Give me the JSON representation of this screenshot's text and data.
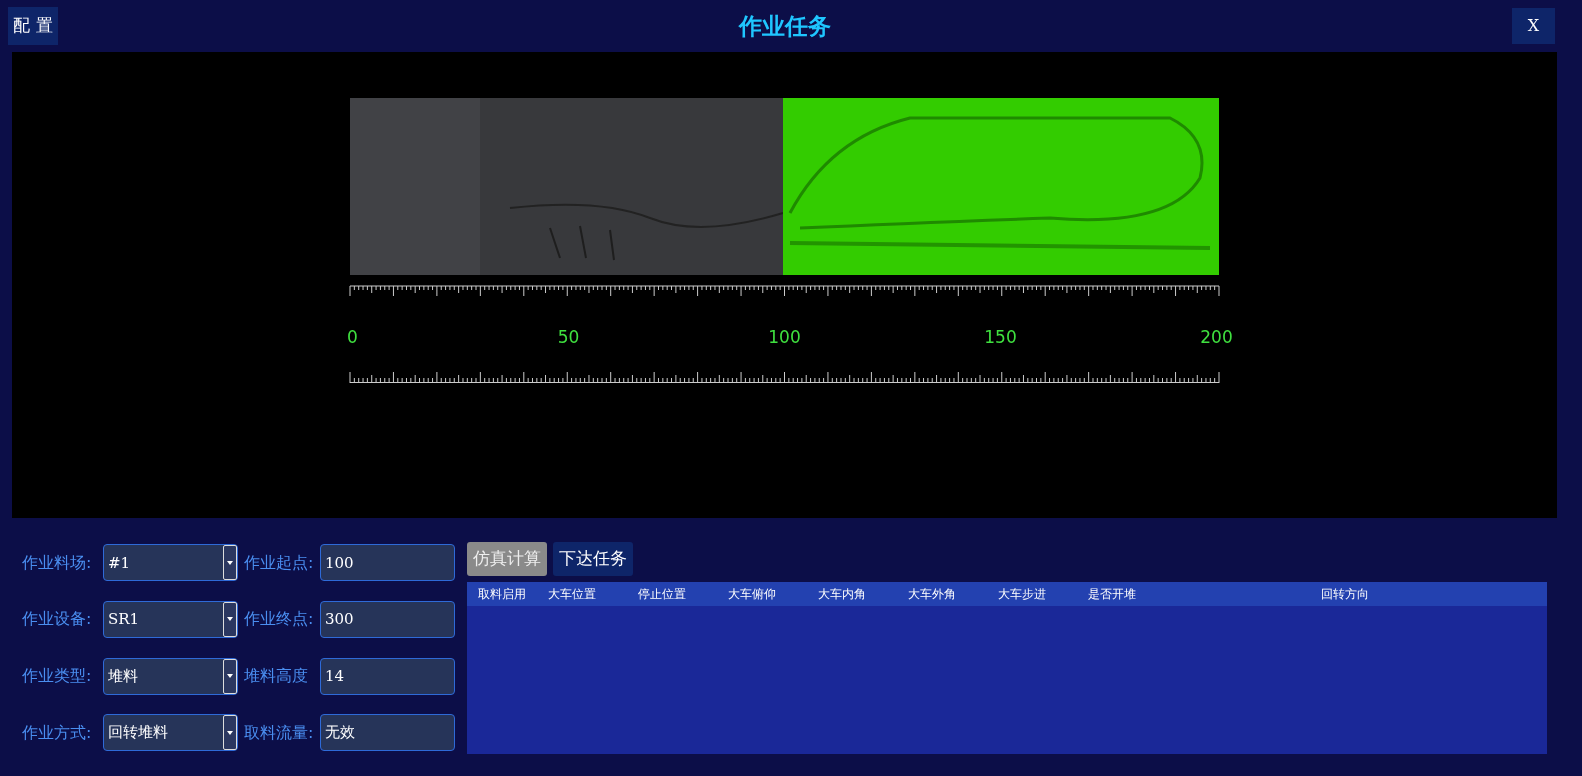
{
  "header": {
    "config_button": "配 置",
    "title": "作业任务",
    "close_button": "X"
  },
  "viewer": {
    "scale_labels": [
      "0",
      "50",
      "100",
      "150",
      "200"
    ]
  },
  "form": {
    "fields": [
      {
        "label": "作业料场:",
        "value": "#1",
        "kind": "select"
      },
      {
        "label": "作业起点:",
        "value": "100",
        "kind": "input"
      },
      {
        "label": "作业设备:",
        "value": "SR1",
        "kind": "select"
      },
      {
        "label": "作业终点:",
        "value": "300",
        "kind": "input"
      },
      {
        "label": "作业类型:",
        "value": "堆料",
        "kind": "select"
      },
      {
        "label": "堆料高度",
        "value": "14",
        "kind": "input"
      },
      {
        "label": "作业方式:",
        "value": "回转堆料",
        "kind": "select"
      },
      {
        "label": "取料流量:",
        "value": "无效",
        "kind": "input"
      }
    ]
  },
  "actions": [
    {
      "label": "仿真计算",
      "selected": true
    },
    {
      "label": "下达任务",
      "selected": false
    }
  ],
  "table": {
    "columns": [
      "取料启用",
      "大车位置",
      "停止位置",
      "大车俯仰",
      "大车内角",
      "大车外角",
      "大车步进",
      "是否开堆",
      "回转方向"
    ]
  }
}
